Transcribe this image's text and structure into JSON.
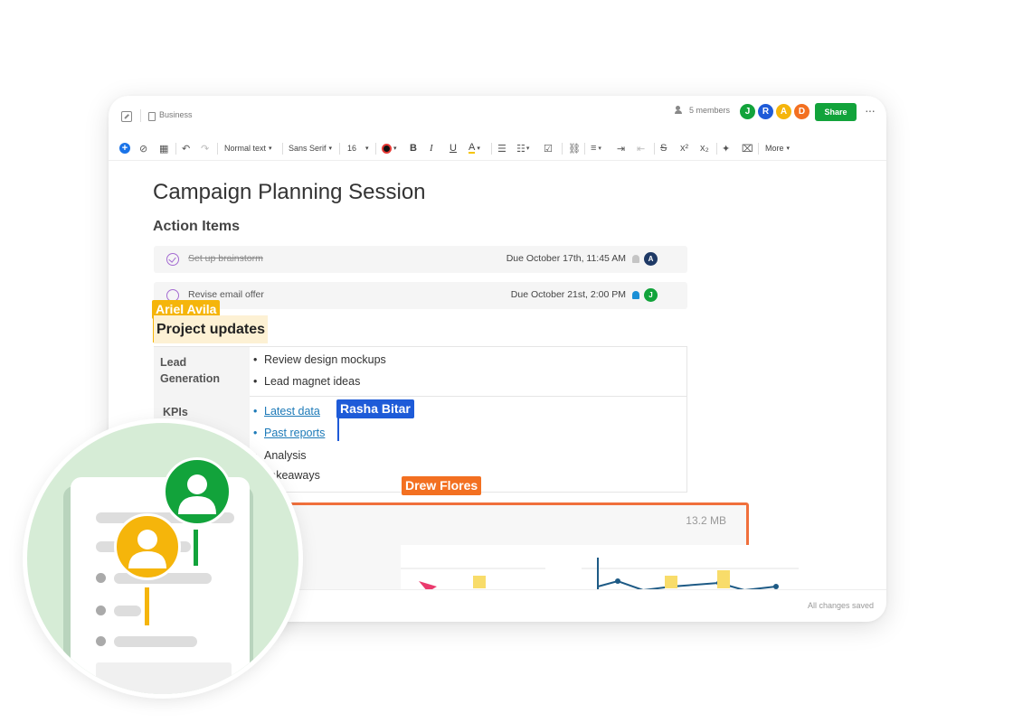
{
  "header": {
    "notebook": "Business",
    "members": "5 members",
    "avatars": [
      {
        "initial": "J",
        "color": "#12a33b"
      },
      {
        "initial": "R",
        "color": "#1e5bd8"
      },
      {
        "initial": "A",
        "color": "#f5b50b"
      },
      {
        "initial": "D",
        "color": "#f37021"
      }
    ],
    "share_label": "Share",
    "more_dots": "···"
  },
  "toolbar": {
    "text_style": "Normal text",
    "font_family": "Sans Serif",
    "font_size": "16",
    "more_label": "More"
  },
  "doc": {
    "title": "Campaign Planning Session",
    "action_items_heading": "Action Items",
    "tasks": [
      {
        "label": "Set up brainstorm",
        "due": "Due October 17th, 11:45 AM",
        "assignee": "A",
        "assignee_color": "#1f3a66",
        "bell_color": "#c5c5c5",
        "done": true
      },
      {
        "label": "Revise email offer",
        "due": "Due October 21st, 2:00 PM",
        "assignee": "J",
        "assignee_color": "#12a33b",
        "bell_color": "#1a8fd6",
        "done": false
      }
    ],
    "project_heading": "Project updates",
    "table": {
      "rows": [
        {
          "label_line1": "Lead",
          "label_line2": "Generation",
          "items": [
            "Review design mockups",
            "Lead magnet ideas"
          ]
        },
        {
          "label": "KPIs",
          "links": [
            "Latest data",
            "Past reports"
          ],
          "items": [
            "Analysis",
            "Takeaways"
          ]
        }
      ]
    },
    "attachment_size": "13.2 MB"
  },
  "cursors": {
    "ariel": {
      "name": "Ariel Avila",
      "color": "#f5b50b"
    },
    "rasha": {
      "name": "Rasha Bitar",
      "color": "#1e5bd8"
    },
    "drew": {
      "name": "Drew Flores",
      "color": "#f37021"
    }
  },
  "status": {
    "saved": "All changes saved"
  }
}
